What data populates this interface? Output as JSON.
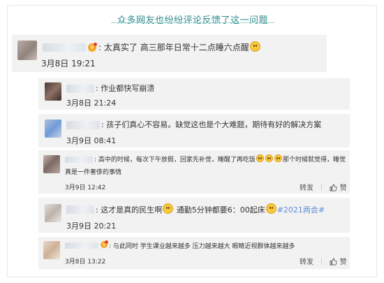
{
  "header": {
    "title": "众多网友也纷纷评论反馈了这一问题"
  },
  "comments": [
    {
      "colon": ":",
      "text": "太真实了 高三那年日常十二点睡六点醒",
      "date": "3月8日 19:21"
    },
    {
      "colon": ":",
      "text": "作业都快写崩溃",
      "date": "3月8日 21:24"
    },
    {
      "colon": ":",
      "text": "孩子们真心不容易。缺觉这也是个大难题，期待有好的解决方案",
      "date": "3月9日 08:41"
    },
    {
      "colon": ":",
      "text_a": "高中的时候，每次下午放假，回家先补觉，睡醒了再吃饭",
      "text_b": "那个时候就觉得，睡觉",
      "text_line2": "真是一件奢侈的事情",
      "date": "3月9日 12:42",
      "repost": "转发",
      "like": "赞"
    },
    {
      "colon": ":",
      "text_a": "这才是真的民生啊",
      "text_b": "通勤5分钟都要6：00起床",
      "hashtag": "#2021两会#",
      "date": "3月9日 20:21"
    },
    {
      "colon": ":",
      "text": "与此同时 学生课业越来越多 压力越来越大 眼睛近视群体越来越多",
      "date": "3月8日 13:22",
      "repost": "转发",
      "like": "赞"
    }
  ],
  "icons": {
    "emoji": "crying-face-emoji",
    "vip": "vip-badge-icon",
    "like": "thumbs-up-icon"
  }
}
